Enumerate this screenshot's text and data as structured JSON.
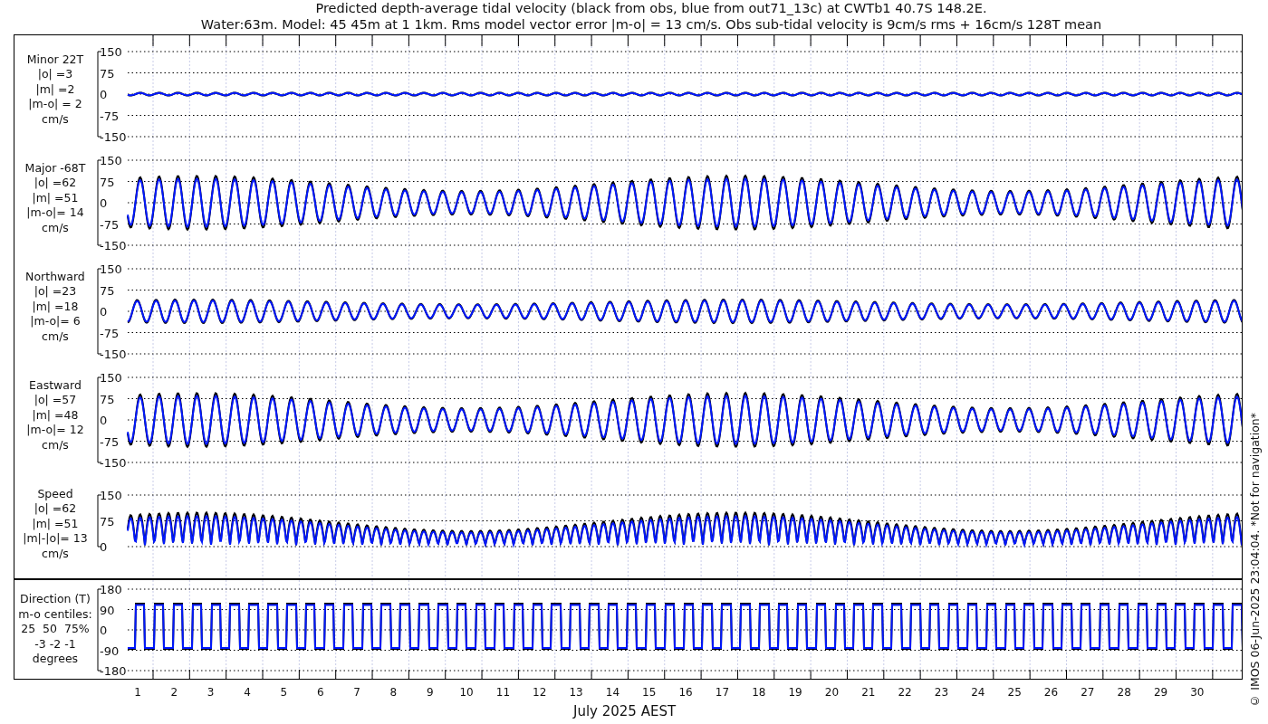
{
  "title": [
    "Predicted depth-average tidal velocity (black from obs, blue from out71_13c) at CWTb1 40.7S 148.2E.",
    "Water:63m. Model: 45 45m at 1 1km. Rms model vector error |m-o| = 13 cm/s. Obs sub-tidal velocity is 9cm/s rms + 16cm/s 128T mean"
  ],
  "panels": [
    {
      "kind": "flat",
      "label": [
        "Minor 22T",
        "|o| =3",
        "|m| =2",
        "|m-o| = 2",
        "cm/s"
      ],
      "yticks": [
        "150",
        "75",
        "0",
        "-75",
        "-150"
      ]
    },
    {
      "kind": "oscillation",
      "label": [
        "Major -68T",
        "|o| =62",
        "|m| =51",
        "|m-o|= 14",
        "cm/s"
      ],
      "yticks": [
        "150",
        "75",
        "0",
        "-75",
        "-150"
      ]
    },
    {
      "kind": "small-oscillation",
      "label": [
        "Northward",
        "|o| =23",
        "|m| =18",
        "|m-o|= 6",
        "cm/s"
      ],
      "yticks": [
        "150",
        "75",
        "0",
        "-75",
        "-150"
      ]
    },
    {
      "kind": "oscillation",
      "label": [
        "Eastward",
        "|o| =57",
        "|m| =48",
        "|m-o|= 12",
        "cm/s"
      ],
      "yticks": [
        "150",
        "75",
        "0",
        "-75",
        "-150"
      ]
    },
    {
      "kind": "speed",
      "label": [
        "Speed",
        "|o| =62",
        "|m| =51",
        "|m|-|o|= 13",
        "cm/s"
      ],
      "yticks": [
        "150",
        "75",
        "0"
      ]
    },
    {
      "kind": "direction",
      "label": [
        "Direction (T)",
        "m-o centiles:",
        "25  50  75%",
        "-3 -2 -1",
        "degrees"
      ],
      "yticks": [
        "180",
        "90",
        "0",
        "-90",
        "-180"
      ]
    }
  ],
  "xticks": [
    "1",
    "2",
    "3",
    "4",
    "5",
    "6",
    "7",
    "8",
    "9",
    "10",
    "11",
    "12",
    "13",
    "14",
    "15",
    "16",
    "17",
    "18",
    "19",
    "20",
    "21",
    "22",
    "23",
    "24",
    "25",
    "26",
    "27",
    "28",
    "29",
    "30"
  ],
  "xlabel": "July 2025 AEST",
  "credit": "© IMOS 06-Jun-2025 23:04:04. *Not for navigation*"
}
